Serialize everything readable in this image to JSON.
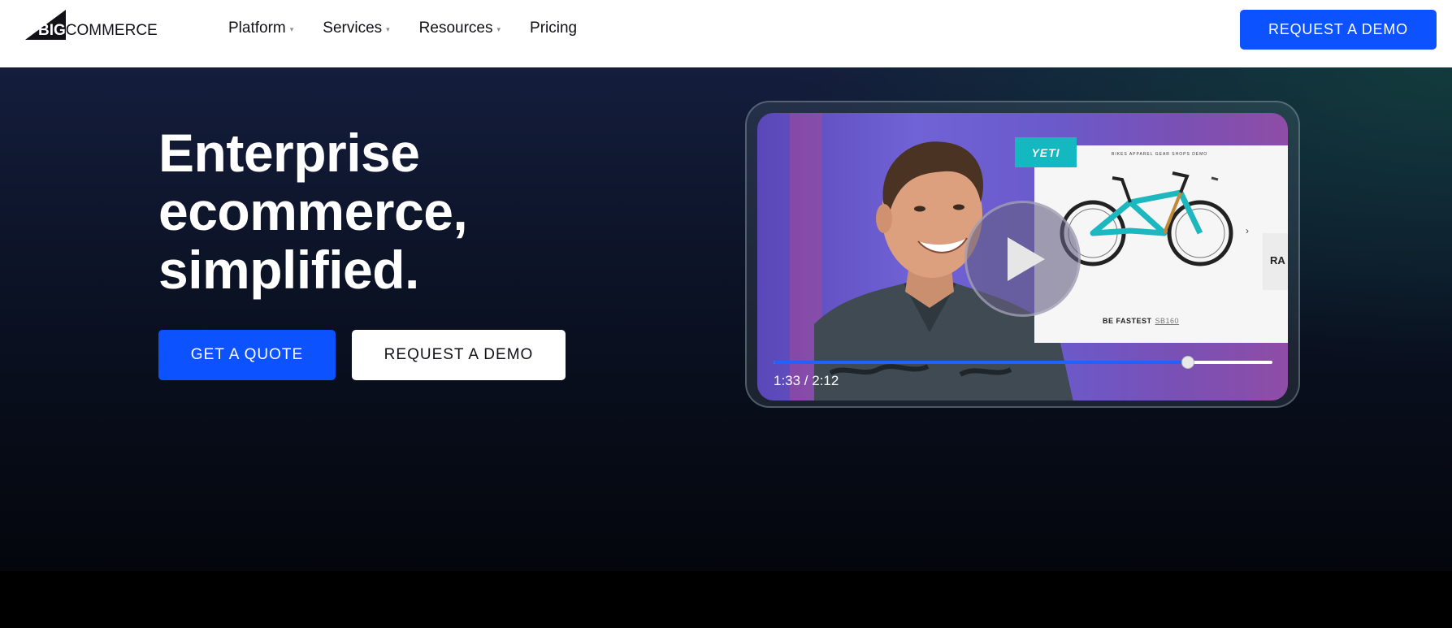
{
  "brand": {
    "logo_text_a": "BIG",
    "logo_text_b": "COMMERCE",
    "accent": "#0d52ff"
  },
  "nav": {
    "items": [
      {
        "label": "Platform",
        "has_dropdown": true
      },
      {
        "label": "Services",
        "has_dropdown": true
      },
      {
        "label": "Resources",
        "has_dropdown": true
      },
      {
        "label": "Pricing",
        "has_dropdown": false
      }
    ],
    "cta_label": "REQUEST A DEMO"
  },
  "hero": {
    "headline_lines": [
      "Enterprise",
      "ecommerce,",
      "simplified."
    ],
    "primary_cta": "GET A QUOTE",
    "secondary_cta": "REQUEST A DEMO"
  },
  "video": {
    "current_time": "1:33",
    "duration": "2:12",
    "time_display": "1:33 / 2:12",
    "progress": 0.83,
    "badge_text": "YETI",
    "site_nav_text": "BIKES APPAREL GEAR SHOPS DEMO",
    "product_caption": "BE FASTEST",
    "product_price": "SB160",
    "side_tile_text": "RA"
  }
}
